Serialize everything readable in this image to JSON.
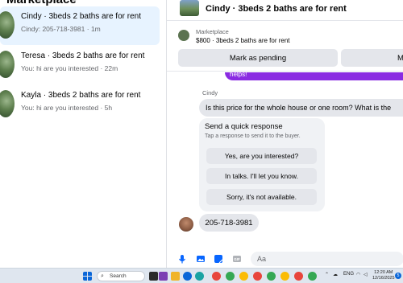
{
  "sidebar": {
    "header": "Marketplace",
    "conversations": [
      {
        "title": "Cindy · 3beds 2 baths are for rent",
        "preview": "Cindy: 205-718-3981 · 1m",
        "active": true
      },
      {
        "title": "Teresa · 3beds 2 baths are for rent",
        "preview": "You: hi are you interested · 22m",
        "active": false
      },
      {
        "title": "Kayla · 3beds 2 baths are for rent",
        "preview": "You: hi are you interested · 5h",
        "active": false
      }
    ]
  },
  "chat": {
    "header_name": "Cindy · 3beds 2 baths are for rent",
    "listing": {
      "source": "Marketplace",
      "price_title": "$800 · 3beds 2 baths are for rent",
      "mark_pending_label": "Mark as pending",
      "more_label": "Mo"
    },
    "cut_message": "helps!",
    "sender_name": "Cindy",
    "message_question": "Is this price for the whole house or one room? What is the",
    "quick_response": {
      "title": "Send a quick response",
      "subtitle": "Tap a response to send it to the buyer.",
      "options": [
        "Yes, are you interested?",
        "In talks. I'll let you know.",
        "Sorry, it's not available."
      ]
    },
    "message_phone": "205-718-3981",
    "composer_placeholder": "Aa"
  },
  "taskbar": {
    "search_label": "Search",
    "language": "ENG",
    "time": "12:20 AM",
    "date": "12/16/2025",
    "notification_count": "5"
  },
  "colors": {
    "active_conversation": "#e7f3ff",
    "accent_blue": "#0866ff",
    "messenger_purple": "#8a2be2",
    "bubble_gray": "#e4e6eb"
  }
}
